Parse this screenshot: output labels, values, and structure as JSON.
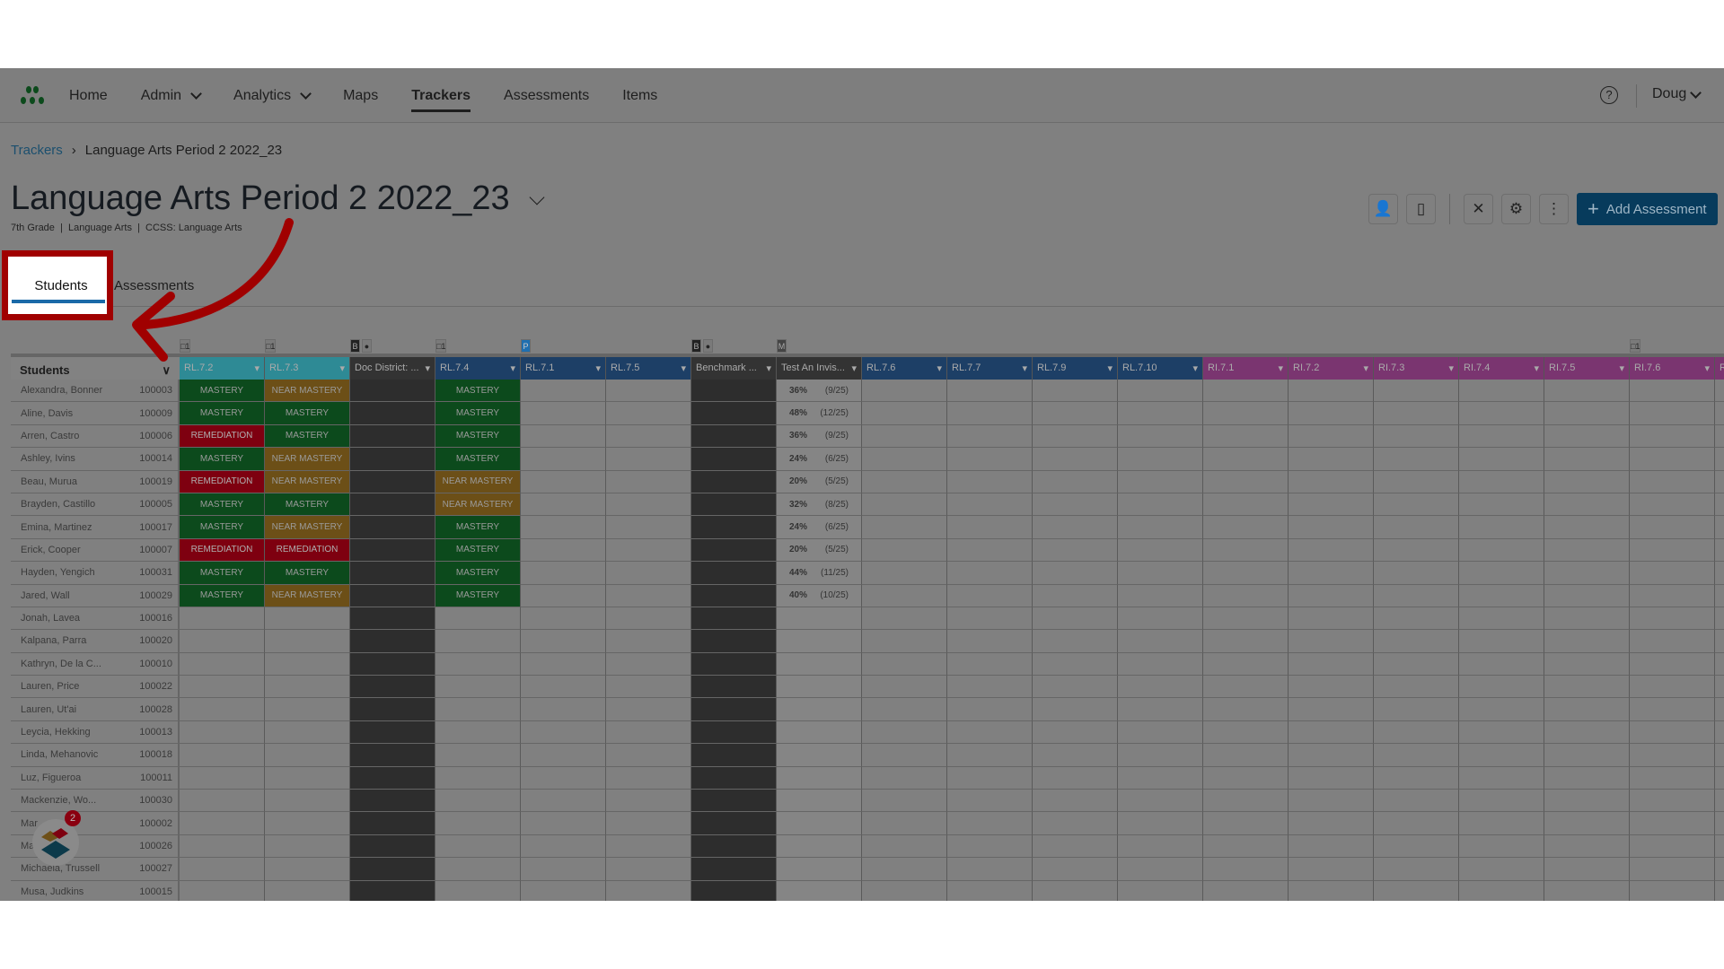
{
  "nav": {
    "items": [
      {
        "label": "Home"
      },
      {
        "label": "Admin",
        "dropdown": true
      },
      {
        "label": "Analytics",
        "dropdown": true
      },
      {
        "label": "Maps"
      },
      {
        "label": "Trackers",
        "active": true
      },
      {
        "label": "Assessments"
      },
      {
        "label": "Items"
      }
    ],
    "help": "?",
    "user": "Doug"
  },
  "breadcrumb": {
    "root": "Trackers",
    "current": "Language Arts Period 2 2022_23"
  },
  "title": "Language Arts Period 2 2022_23",
  "subtitle": "7th Grade  |  Language Arts  |  CCSS: Language Arts",
  "toolbar": {
    "add_label": "Add Assessment",
    "icons": [
      "student-icon",
      "notebook-icon",
      "tools-icon",
      "gear-icon",
      "more-icon"
    ]
  },
  "tabs": [
    {
      "label": "Students",
      "active": true
    },
    {
      "label": "Assessments"
    }
  ],
  "grid": {
    "students_header": "Students",
    "columns": [
      {
        "label": "RL.7.2",
        "color": "#2e8a95",
        "flag": "□1"
      },
      {
        "label": "RL.7.3",
        "color": "#2e8a95",
        "flag": "□1"
      },
      {
        "label": "Doc District: ...",
        "color": "#333333",
        "flag": "B●",
        "dark": true
      },
      {
        "label": "RL.7.4",
        "color": "#1d3f66",
        "flag": "□1"
      },
      {
        "label": "RL.7.1",
        "color": "#1d3f66",
        "flag": "P"
      },
      {
        "label": "RL.7.5",
        "color": "#1d3f66"
      },
      {
        "label": "Benchmark ...",
        "color": "#333333",
        "flag": "B●",
        "dark": true
      },
      {
        "label": "Test An Invis...",
        "color": "#333333",
        "flag": "M"
      },
      {
        "label": "RL.7.6",
        "color": "#1d3f66"
      },
      {
        "label": "RL.7.7",
        "color": "#1d3f66"
      },
      {
        "label": "RL.7.9",
        "color": "#1d3f66"
      },
      {
        "label": "RL.7.10",
        "color": "#1d3f66"
      },
      {
        "label": "RI.7.1",
        "color": "#7a3570"
      },
      {
        "label": "RI.7.2",
        "color": "#7a3570"
      },
      {
        "label": "RI.7.3",
        "color": "#7a3570"
      },
      {
        "label": "RI.7.4",
        "color": "#7a3570"
      },
      {
        "label": "RI.7.5",
        "color": "#7a3570"
      },
      {
        "label": "RI.7.6",
        "color": "#7a3570",
        "flag": "□1"
      },
      {
        "label": "R",
        "color": "#7a3570"
      }
    ],
    "legend": {
      "M": "MASTERY",
      "N": "NEAR MASTERY",
      "R": "REMEDIATION"
    },
    "rows": [
      {
        "name": "Alexandra, Bonner",
        "id": "100003",
        "scores": [
          "M",
          "N",
          "",
          "M"
        ],
        "test": [
          "36%",
          "(9/25)"
        ]
      },
      {
        "name": "Aline, Davis",
        "id": "100009",
        "scores": [
          "M",
          "M",
          "",
          "M"
        ],
        "test": [
          "48%",
          "(12/25)"
        ]
      },
      {
        "name": "Arren, Castro",
        "id": "100006",
        "scores": [
          "R",
          "M",
          "",
          "M"
        ],
        "test": [
          "36%",
          "(9/25)"
        ]
      },
      {
        "name": "Ashley, Ivins",
        "id": "100014",
        "scores": [
          "M",
          "N",
          "",
          "M"
        ],
        "test": [
          "24%",
          "(6/25)"
        ]
      },
      {
        "name": "Beau, Murua",
        "id": "100019",
        "scores": [
          "R",
          "N",
          "",
          "N"
        ],
        "test": [
          "20%",
          "(5/25)"
        ]
      },
      {
        "name": "Brayden, Castillo",
        "id": "100005",
        "scores": [
          "M",
          "M",
          "",
          "N"
        ],
        "test": [
          "32%",
          "(8/25)"
        ]
      },
      {
        "name": "Emina, Martinez",
        "id": "100017",
        "scores": [
          "M",
          "N",
          "",
          "M"
        ],
        "test": [
          "24%",
          "(6/25)"
        ]
      },
      {
        "name": "Erick, Cooper",
        "id": "100007",
        "scores": [
          "R",
          "R",
          "",
          "M"
        ],
        "test": [
          "20%",
          "(5/25)"
        ]
      },
      {
        "name": "Hayden, Yengich",
        "id": "100031",
        "scores": [
          "M",
          "M",
          "",
          "M"
        ],
        "test": [
          "44%",
          "(11/25)"
        ]
      },
      {
        "name": "Jared, Wall",
        "id": "100029",
        "scores": [
          "M",
          "N",
          "",
          "M"
        ],
        "test": [
          "40%",
          "(10/25)"
        ]
      },
      {
        "name": "Jonah, Lavea",
        "id": "100016"
      },
      {
        "name": "Kalpana, Parra",
        "id": "100020"
      },
      {
        "name": "Kathryn, De la C...",
        "id": "100010"
      },
      {
        "name": "Lauren, Price",
        "id": "100022"
      },
      {
        "name": "Lauren, Ut'ai",
        "id": "100028"
      },
      {
        "name": "Leycia, Hekking",
        "id": "100013"
      },
      {
        "name": "Linda, Mehanovic",
        "id": "100018"
      },
      {
        "name": "Luz, Figueroa",
        "id": "100011"
      },
      {
        "name": "Mackenzie, Wo...",
        "id": "100030"
      },
      {
        "name": "Mar",
        "id": "100002"
      },
      {
        "name": "Ma",
        "id": "100026"
      },
      {
        "name": "Michaela, Trussell",
        "id": "100027"
      },
      {
        "name": "Musa, Judkins",
        "id": "100015"
      }
    ]
  },
  "chat": {
    "badge": "2"
  }
}
